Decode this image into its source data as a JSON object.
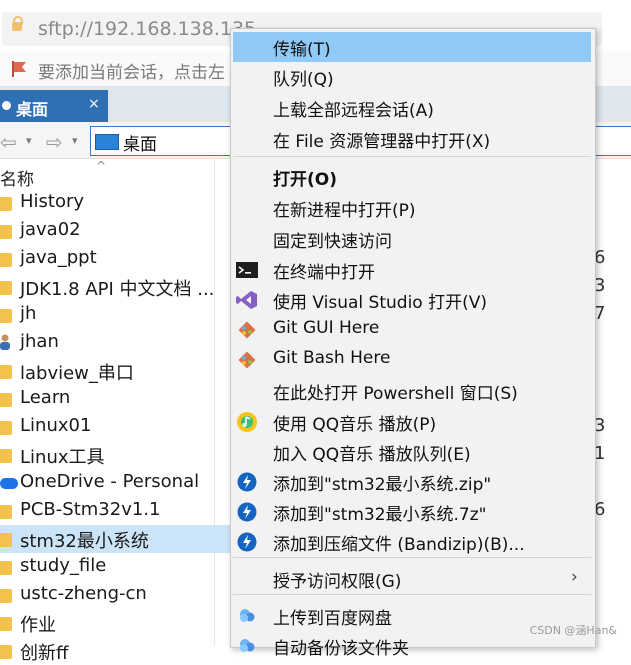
{
  "address": {
    "url": "sftp://192.168.138.135"
  },
  "notice": {
    "text": "要添加当前会话，点击左"
  },
  "tab": {
    "label": "桌面",
    "close": "×"
  },
  "nav": {
    "back": "⇦",
    "forward": "⇨",
    "dropdown": "▾",
    "path": "桌面"
  },
  "columns": {
    "name": "名称",
    "sort": "^"
  },
  "files": [
    {
      "name": "History",
      "kind": "folder"
    },
    {
      "name": "java02",
      "kind": "folder"
    },
    {
      "name": "java_ppt",
      "kind": "folder"
    },
    {
      "name": "JDK1.8 API 中文文档 ...",
      "kind": "folder"
    },
    {
      "name": "jh",
      "kind": "folder"
    },
    {
      "name": "jhan",
      "kind": "user"
    },
    {
      "name": "labview_串口",
      "kind": "folder"
    },
    {
      "name": "Learn",
      "kind": "folder"
    },
    {
      "name": "Linux01",
      "kind": "folder"
    },
    {
      "name": "Linux工具",
      "kind": "folder"
    },
    {
      "name": "OneDrive - Personal",
      "kind": "cloud"
    },
    {
      "name": "PCB-Stm32v1.1",
      "kind": "folder"
    },
    {
      "name": "stm32最小系统",
      "kind": "folder",
      "selected": true
    },
    {
      "name": "study_file",
      "kind": "folder"
    },
    {
      "name": "ustc-zheng-cn",
      "kind": "folder"
    },
    {
      "name": "作业",
      "kind": "folder"
    },
    {
      "name": "创新ff",
      "kind": "folder"
    }
  ],
  "right_digits": [
    "6",
    "3",
    "7",
    "3",
    "1",
    "6"
  ],
  "menu": {
    "items": [
      {
        "label": "传输(T)",
        "highlight": true
      },
      {
        "label": "队列(Q)"
      },
      {
        "label": "上载全部远程会话(A)"
      },
      {
        "label": "在 File 资源管理器中打开(X)"
      },
      {
        "label": "打开(O)",
        "bold": true
      },
      {
        "label": "在新进程中打开(P)"
      },
      {
        "label": "固定到快速访问"
      },
      {
        "label": "在终端中打开",
        "icon": "terminal-icon"
      },
      {
        "label": "使用 Visual Studio 打开(V)",
        "icon": "visual-studio-icon"
      },
      {
        "label": "Git GUI Here",
        "icon": "git-icon"
      },
      {
        "label": "Git Bash Here",
        "icon": "git-icon"
      },
      {
        "label": "在此处打开 Powershell 窗口(S)"
      },
      {
        "label": "使用 QQ音乐 播放(P)",
        "icon": "qq-music-icon"
      },
      {
        "label": "加入 QQ音乐 播放队列(E)"
      },
      {
        "label": "添加到\"stm32最小系统.zip\"",
        "icon": "bandizip-icon"
      },
      {
        "label": "添加到\"stm32最小系统.7z\"",
        "icon": "bandizip-icon"
      },
      {
        "label": "添加到压缩文件 (Bandizip)(B)...",
        "icon": "bandizip-icon"
      },
      {
        "label": "授予访问权限(G)",
        "submenu": true
      },
      {
        "label": "上传到百度网盘",
        "icon": "baidu-netdisk-icon"
      },
      {
        "label": "自动备份该文件夹",
        "icon": "baidu-netdisk-icon"
      }
    ],
    "submenu_arrow": "›"
  },
  "watermark": "CSDN @涵Han&"
}
